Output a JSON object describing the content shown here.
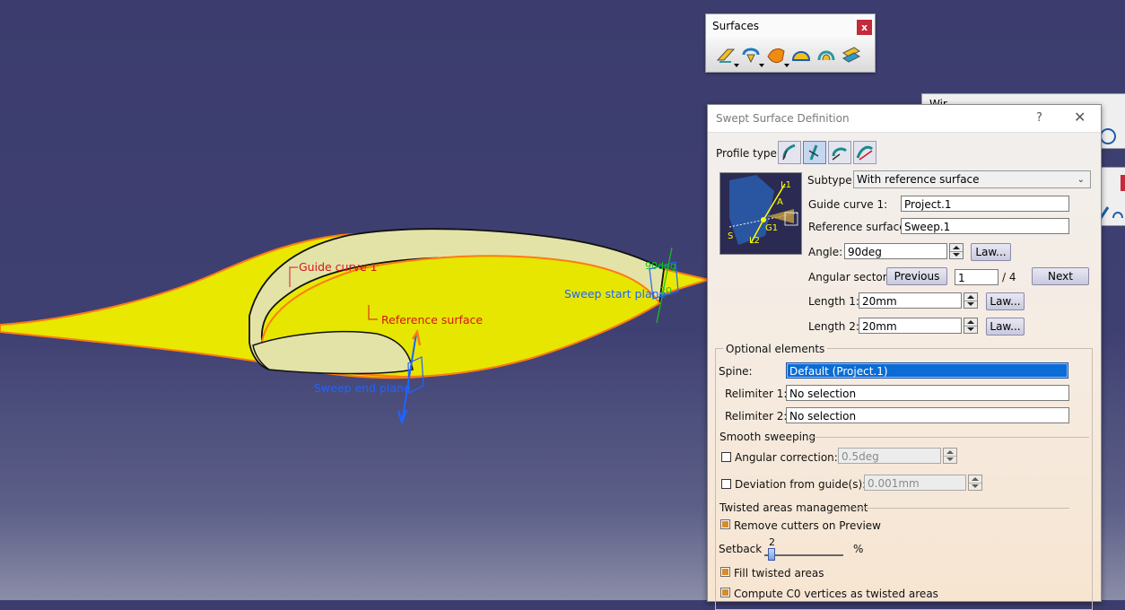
{
  "viewport": {
    "labels": {
      "guide_curve": "Guide curve 1",
      "reference_surface": "Reference surface",
      "sweep_start_plane": "Sweep start plane",
      "sweep_end_plane": "Sweep end plane",
      "angle_tag": "90deg",
      "length_tag": "20"
    }
  },
  "surfaces_toolbar": {
    "title": "Surfaces",
    "close": "x",
    "icons": [
      "extrude-surface-icon",
      "revolve-surface-icon",
      "sweep-surface-icon",
      "fill-surface-icon",
      "multi-section-surface-icon",
      "blend-surface-icon"
    ]
  },
  "wireframe_toolbar": {
    "title": "Wir..."
  },
  "dialog": {
    "title": "Swept Surface Definition",
    "help": "?",
    "close": "✕",
    "profile_type_label": "Profile type:",
    "profile_types": [
      "explicit",
      "line",
      "circle",
      "conic"
    ],
    "subtype_label": "Subtype:",
    "subtype_value": "With reference surface",
    "guide_curve_label": "Guide curve 1:",
    "guide_curve_value": "Project.1",
    "reference_surface_label": "Reference surface:",
    "reference_surface_value": "Sweep.1",
    "angle_label": "Angle:",
    "angle_value": "90deg",
    "law_label": "Law...",
    "angular_sector_label": "Angular sector:",
    "previous_label": "Previous",
    "sector_value": "1",
    "sector_total": "/ 4",
    "next_label": "Next",
    "length1_label": "Length 1:",
    "length1_value": "20mm",
    "length2_label": "Length 2:",
    "length2_value": "20mm",
    "optional_elements_label": "Optional elements",
    "spine_label": "Spine:",
    "spine_value": "Default (Project.1)",
    "relimiter1_label": "Relimiter 1:",
    "relimiter1_value": "No selection",
    "relimiter2_label": "Relimiter 2:",
    "relimiter2_value": "No selection",
    "smooth_sweeping_label": "Smooth sweeping",
    "angular_correction_label": "Angular correction:",
    "angular_correction_value": "0.5deg",
    "angular_correction_checked": false,
    "deviation_label": "Deviation from guide(s):",
    "deviation_value": "0.001mm",
    "deviation_checked": false,
    "twisted_label": "Twisted areas management",
    "remove_cutters_label": "Remove cutters on Preview",
    "remove_cutters_checked": true,
    "setback_label": "Setback",
    "setback_value": "2",
    "setback_unit": "%",
    "fill_twisted_label": "Fill twisted areas",
    "fill_twisted_checked": true,
    "compute_c0_label": "Compute C0 vertices as twisted areas",
    "compute_c0_checked": true,
    "preview_labels": {
      "l1": "L1",
      "l2": "L2",
      "a": "A",
      "g1": "G1",
      "s": "S"
    }
  },
  "colors": {
    "viewport_bg": "#3c3d6e",
    "surface_yellow": "#e8e800",
    "surface_pale": "#e3e3a8",
    "edge_orange": "#ff7a14",
    "label_red": "#d8141e",
    "label_blue": "#1e64ff",
    "selection_blue": "#0a6cd4"
  }
}
